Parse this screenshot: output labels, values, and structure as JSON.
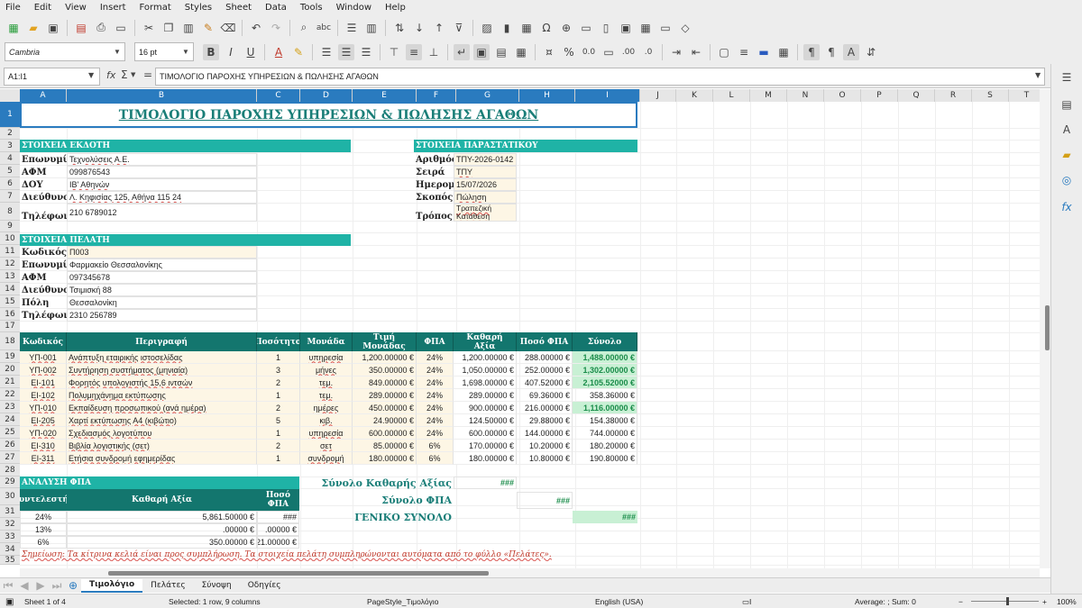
{
  "menu": [
    "File",
    "Edit",
    "View",
    "Insert",
    "Format",
    "Styles",
    "Sheet",
    "Data",
    "Tools",
    "Window",
    "Help"
  ],
  "toolbar": {
    "font_name": "Cambria",
    "font_size": "16 pt"
  },
  "formula_bar": {
    "name_box": "A1:I1",
    "formula": "ΤΙΜΟΛΟΓΙΟ ΠΑΡΟΧΗΣ ΥΠΗΡΕΣΙΩΝ & ΠΩΛΗΣΗΣ ΑΓΑΘΩΝ"
  },
  "columns": [
    "A",
    "B",
    "C",
    "D",
    "E",
    "F",
    "G",
    "H",
    "I",
    "J",
    "K",
    "L",
    "M",
    "N",
    "O",
    "P",
    "Q",
    "R",
    "S",
    "T"
  ],
  "rows": [
    "1",
    "2",
    "3",
    "4",
    "5",
    "6",
    "7",
    "8",
    "9",
    "10",
    "11",
    "12",
    "13",
    "14",
    "15",
    "16",
    "17",
    "18",
    "19",
    "20",
    "21",
    "22",
    "23",
    "24",
    "25",
    "26",
    "27",
    "28",
    "29",
    "30",
    "31",
    "32",
    "33",
    "34",
    "35"
  ],
  "title": "ΤΙΜΟΛΟΓΙΟ ΠΑΡΟΧΗΣ ΥΠΗΡΕΣΙΩΝ & ΠΩΛΗΣΗΣ ΑΓΑΘΩΝ",
  "issuer": {
    "header": "ΣΤΟΙΧΕΙΑ ΕΚΔΟΤΗ",
    "rows": [
      {
        "label": "Επωνυμία",
        "value": "Τεχνολύσεις Α.Ε."
      },
      {
        "label": "ΑΦΜ",
        "value": "099876543"
      },
      {
        "label": "ΔΟΥ",
        "value": "ΙΒ' Αθηνών"
      },
      {
        "label": "Διεύθυνση",
        "value": "Λ. Κηφισίας 125, Αθήνα 115 24"
      },
      {
        "label": "Τηλέφωνο",
        "value": "210 6789012"
      }
    ]
  },
  "document": {
    "header": "ΣΤΟΙΧΕΙΑ ΠΑΡΑΣΤΑΤΙΚΟΥ",
    "rows": [
      {
        "label": "Αριθμός",
        "value": "ΤΠΥ-2026-0142"
      },
      {
        "label": "Σειρά",
        "value": "ΤΠΥ"
      },
      {
        "label": "Ημερομηνία",
        "value": "15/07/2026"
      },
      {
        "label": "Σκοπός",
        "value": "Πώληση"
      },
      {
        "label": "Τρόπος",
        "value": "Τραπεζική Κατάθεση"
      }
    ]
  },
  "customer": {
    "header": "ΣΤΟΙΧΕΙΑ ΠΕΛΑΤΗ",
    "rows": [
      {
        "label": "Κωδικός Πελάτη",
        "value": "Π003"
      },
      {
        "label": "Επωνυμία",
        "value": "Φαρμακείο Θεσσαλονίκης"
      },
      {
        "label": "ΑΦΜ",
        "value": "097345678"
      },
      {
        "label": "Διεύθυνση",
        "value": "Τσιμισκή 88"
      },
      {
        "label": "Πόλη",
        "value": "Θεσσαλονίκη"
      },
      {
        "label": "Τηλέφωνο",
        "value": "2310 256789"
      }
    ]
  },
  "items_table": {
    "headers": [
      "Κωδικός",
      "Περιγραφή",
      "Ποσότητα",
      "Μονάδα",
      "Τιμή Μονάδας",
      "ΦΠΑ",
      "Καθαρή Αξία",
      "Ποσό ΦΠΑ",
      "Σύνολο"
    ],
    "rows": [
      [
        "ΥΠ-001",
        "Ανάπτυξη εταιρικής ιστοσελίδας",
        "1",
        "υπηρεσία",
        "1,200.00000 €",
        "24%",
        "1,200.00000 €",
        "288.00000 €",
        "1,488.00000 €"
      ],
      [
        "ΥΠ-002",
        "Συντήρηση συστήματος (μηνιαία)",
        "3",
        "μήνες",
        "350.00000 €",
        "24%",
        "1,050.00000 €",
        "252.00000 €",
        "1,302.00000 €"
      ],
      [
        "ΕΙ-101",
        "Φορητός υπολογιστής 15,6 ιντσών",
        "2",
        "τεμ.",
        "849.00000 €",
        "24%",
        "1,698.00000 €",
        "407.52000 €",
        "2,105.52000 €"
      ],
      [
        "ΕΙ-102",
        "Πολυμηχάνημα εκτύπωσης",
        "1",
        "τεμ.",
        "289.00000 €",
        "24%",
        "289.00000 €",
        "69.36000 €",
        "358.36000 €"
      ],
      [
        "ΥΠ-010",
        "Εκπαίδευση προσωπικού (ανά ημέρα)",
        "2",
        "ημέρες",
        "450.00000 €",
        "24%",
        "900.00000 €",
        "216.00000 €",
        "1,116.00000 €"
      ],
      [
        "ΕΙ-205",
        "Χαρτί εκτύπωσης Α4 (κιβώτιο)",
        "5",
        "κιβ.",
        "24.90000 €",
        "24%",
        "124.50000 €",
        "29.88000 €",
        "154.38000 €"
      ],
      [
        "ΥΠ-020",
        "Σχεδιασμός λογοτύπου",
        "1",
        "υπηρεσία",
        "600.00000 €",
        "24%",
        "600.00000 €",
        "144.00000 €",
        "744.00000 €"
      ],
      [
        "ΕΙ-310",
        "Βιβλία λογιστικής (σετ)",
        "2",
        "σετ",
        "85.00000 €",
        "6%",
        "170.00000 €",
        "10.20000 €",
        "180.20000 €"
      ],
      [
        "ΕΙ-311",
        "Ετήσια συνδρομή εφημερίδας",
        "1",
        "συνδρομή",
        "180.00000 €",
        "6%",
        "180.00000 €",
        "10.80000 €",
        "190.80000 €"
      ]
    ]
  },
  "vat_analysis": {
    "header": "ΑΝΑΛΥΣΗ ΦΠΑ",
    "col_headers": [
      "Συντελεστής",
      "Καθαρή Αξία",
      "Ποσό ΦΠΑ"
    ],
    "rows": [
      [
        "24%",
        "5,861.50000 €",
        "###"
      ],
      [
        "13%",
        ".00000 €",
        ".00000 €"
      ],
      [
        "6%",
        "350.00000 €",
        "21.00000 €"
      ]
    ]
  },
  "totals": {
    "net_label": "Σύνολο Καθαρής Αξίας",
    "net_value": "###",
    "vat_label": "Σύνολο ΦΠΑ",
    "vat_value": "###",
    "grand_label": "ΓΕΝΙΚΟ ΣΥΝΟΛΟ",
    "grand_value": "###"
  },
  "note": "Σημείωση: Τα κίτρινα κελιά είναι προς συμπλήρωση. Τα στοιχεία πελάτη συμπληρώνονται αυτόματα από το φύλλο «Πελάτες».",
  "sheets": [
    "Τιμολόγιο",
    "Πελάτες",
    "Σύνοψη",
    "Οδηγίες"
  ],
  "status": {
    "sheet": "Sheet 1 of 4",
    "selection": "Selected: 1 row, 9 columns",
    "pagestyle": "PageStyle_Τιμολόγιο",
    "language": "English (USA)",
    "sum": "Average: ; Sum: 0",
    "zoom": "100%"
  },
  "colors": {
    "teal": "#1fb3a6",
    "dark_teal": "#13766e",
    "cream": "#fdf6e5",
    "green": "#c8f0d4",
    "selection": "#2a7bbf"
  }
}
